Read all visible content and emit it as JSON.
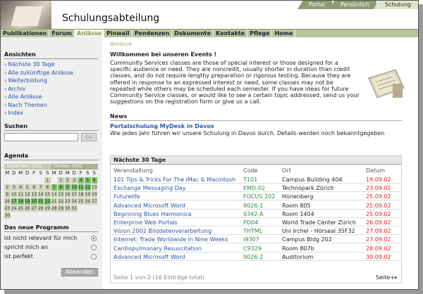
{
  "header": {
    "title": "Schulungsabteilung",
    "top_tabs": [
      {
        "label": "Portal",
        "active": false
      },
      {
        "label": "Persönlich",
        "active": false
      },
      {
        "label": "Schulung",
        "active": true
      }
    ]
  },
  "nav": {
    "items": [
      {
        "label": "Publikationen",
        "active": false
      },
      {
        "label": "Forum",
        "active": false
      },
      {
        "label": "Anlässe",
        "active": true
      },
      {
        "label": "Pinwall",
        "active": false
      },
      {
        "label": "Pendenzen",
        "active": false
      },
      {
        "label": "Dokumente",
        "active": false
      },
      {
        "label": "Kontakte",
        "active": false
      },
      {
        "label": "Pflege",
        "active": false
      },
      {
        "label": "Home",
        "active": false
      }
    ]
  },
  "sidebar": {
    "views_title": "Ansichten",
    "views": [
      "Nächste 30 Tage",
      "Alle zukünftige Anlässe",
      "Weiterbildung",
      "Archiv",
      "Alle Anlässe",
      "Nach Themen",
      "Index"
    ],
    "search_title": "Suchen",
    "search_value": "",
    "search_button": "Go",
    "agenda_title": "Agenda",
    "calendar": {
      "months": [
        "September 2002",
        "Oktober 2002"
      ],
      "weekdays": [
        "M",
        "D",
        "M",
        "D",
        "F",
        "S",
        "S",
        "M",
        "D",
        "M",
        "D",
        "F",
        "S",
        "S"
      ],
      "rows": [
        [
          "",
          "",
          "",
          "",
          "",
          "",
          "1",
          "",
          "1",
          "2",
          "3",
          "4",
          "5",
          "6"
        ],
        [
          "2",
          "3",
          "4",
          "5",
          "6",
          "7",
          "8",
          "7",
          "8",
          "9",
          "10",
          "11",
          "12",
          "13"
        ],
        [
          "9",
          "10",
          "11",
          "12",
          "13",
          "14",
          "15",
          "14",
          "15",
          "16",
          "17",
          "18",
          "19",
          "20"
        ],
        [
          "16",
          "17",
          "18",
          "19",
          "20",
          "21",
          "22",
          "21",
          "22",
          "23",
          "24",
          "25",
          "26",
          "27"
        ],
        [
          "23",
          "24",
          "25",
          "26",
          "27",
          "28",
          "29",
          "28",
          "29",
          "30",
          "31",
          "",
          "",
          ""
        ],
        [
          "30",
          "",
          "",
          "",
          "",
          "",
          "",
          "",
          "",
          "",
          "",
          "",
          "",
          ""
        ]
      ],
      "event_cells": [
        [
          0,
          11
        ],
        [
          0,
          12
        ],
        [
          0,
          13
        ],
        [
          1,
          7
        ],
        [
          1,
          8
        ],
        [
          1,
          9
        ],
        [
          1,
          10
        ],
        [
          1,
          11
        ],
        [
          1,
          12
        ],
        [
          3,
          1
        ],
        [
          3,
          2
        ],
        [
          3,
          3
        ],
        [
          3,
          4
        ],
        [
          3,
          5
        ],
        [
          3,
          6
        ]
      ]
    },
    "poll_title": "Das neue Programm",
    "poll_options": [
      {
        "label": "ist nicht relevant für mich",
        "selected": true
      },
      {
        "label": "spricht mich an",
        "selected": false
      },
      {
        "label": "ist perfekt",
        "selected": false
      }
    ],
    "vote_button": "Absenden"
  },
  "main": {
    "breadcrumb": "Anlässe",
    "welcome_title": "Willkommen bei unseren Events !",
    "welcome_text": "Community Services classes are those of special interest or those designed for a specific audience or need.  They are noncredit, usually shorter in duration than credit classes, and do not require lengthy preparation or rigorous testing.  Because they are offered in response to an expressed interest or need, some classes may not be repeated while others may be scheduled each semester. If you have ideas for future Community Service classes, or would like to see a certain topic addressed, send us your suggestions on the registration form or give us a call.",
    "news_title": "News",
    "news_link": "Portalschulung MyDesk in Davos",
    "news_text": "Wie jedes Jahr führen wir unsere Schulung in Davos durch. Details werden noch bekanntgegeben",
    "events_title": "Nächste 30 Tage",
    "columns": [
      "Veranstaltung",
      "Code",
      "Ort",
      "Datum"
    ],
    "events": [
      {
        "name": "101 Tips & Tricks For The iMac & Macintosh",
        "code": "T101",
        "place": "Campus Building 404",
        "date": "19.09.02"
      },
      {
        "name": "Exchange Messaging Day",
        "code": "EMD-02",
        "place": "Technopark Zürich",
        "date": "23.09.02"
      },
      {
        "name": "Futurelife",
        "code": "FOCUS 202",
        "place": "Hünenberg",
        "date": "25.09.02"
      },
      {
        "name": "Advanced Microsoft Word",
        "code": "9026-1",
        "place": "Room 805",
        "date": "25.09.02"
      },
      {
        "name": "Beginning Blues Harmonica",
        "code": "9342-A",
        "place": "Room 1404",
        "date": "25.09.02"
      },
      {
        "name": "Enterprise Web Portals",
        "code": "PD04",
        "place": "World Trade Center Zürich",
        "date": "26.09.02"
      },
      {
        "name": "Vision 2002 Bilddatenverarbeitung",
        "code": "THTML",
        "place": "Uni Irchel - Hörsaal 35F32",
        "date": "27.09.02"
      },
      {
        "name": "Internet: Trade Worldwide In Nine Weeks",
        "code": "I9307",
        "place": "Campus Bldg 202",
        "date": "27.09.02"
      },
      {
        "name": "Cardiopulmonary Resuscitation",
        "code": "C9329",
        "place": "Room 807b",
        "date": "28.09.02"
      },
      {
        "name": "Advanced Microsoft Word",
        "code": "9026-2",
        "place": "Auditorium",
        "date": "30.09.02"
      }
    ],
    "pager_text": "Seite 1 von 2 (16 Einträge total)",
    "next_label": "Seite+",
    "next_arrow": "▸"
  }
}
